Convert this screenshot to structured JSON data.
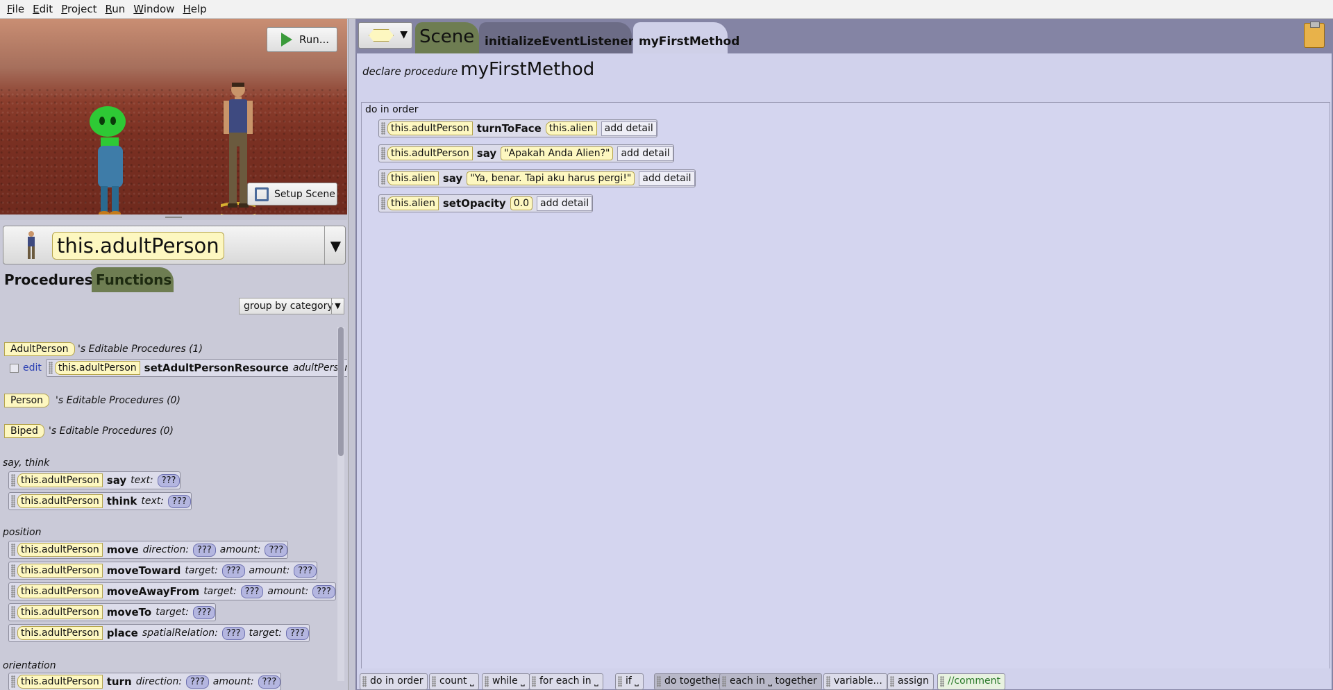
{
  "menu": [
    "File",
    "Edit",
    "Project",
    "Run",
    "Window",
    "Help"
  ],
  "scene_view": {
    "run_label": "Run...",
    "setup_label": "Setup Scene"
  },
  "object_selector": {
    "selected": "this.adultPerson"
  },
  "left_tabs": {
    "procedures": "Procedures",
    "functions": "Functions"
  },
  "group_by": "group by category",
  "editable": [
    {
      "class": "AdultPerson",
      "suffix": "'s Editable Procedures (1)"
    },
    {
      "class": "Person",
      "suffix": "'s Editable Procedures (0)"
    },
    {
      "class": "Biped",
      "suffix": "'s Editable Procedures (0)"
    }
  ],
  "edit_row": {
    "edit": "edit",
    "target": "this.adultPerson",
    "method": "setAdultPersonResource",
    "arg": "adultPerson"
  },
  "categories": {
    "say_think": "say, think",
    "position": "position",
    "orientation": "orientation"
  },
  "proc_blocks": {
    "say": {
      "target": "this.adultPerson",
      "method": "say",
      "args": [
        {
          "name": "text:",
          "val": "???"
        }
      ]
    },
    "think": {
      "target": "this.adultPerson",
      "method": "think",
      "args": [
        {
          "name": "text:",
          "val": "???"
        }
      ]
    },
    "move": {
      "target": "this.adultPerson",
      "method": "move",
      "args": [
        {
          "name": "direction:",
          "val": "???"
        },
        {
          "name": "amount:",
          "val": "???"
        }
      ]
    },
    "moveToward": {
      "target": "this.adultPerson",
      "method": "moveToward",
      "args": [
        {
          "name": "target:",
          "val": "???"
        },
        {
          "name": "amount:",
          "val": "???"
        }
      ]
    },
    "moveAwayFrom": {
      "target": "this.adultPerson",
      "method": "moveAwayFrom",
      "args": [
        {
          "name": "target:",
          "val": "???"
        },
        {
          "name": "amount:",
          "val": "???"
        }
      ]
    },
    "moveTo": {
      "target": "this.adultPerson",
      "method": "moveTo",
      "args": [
        {
          "name": "target:",
          "val": "???"
        }
      ]
    },
    "place": {
      "target": "this.adultPerson",
      "method": "place",
      "args": [
        {
          "name": "spatialRelation:",
          "val": "???"
        },
        {
          "name": "target:",
          "val": "???"
        }
      ]
    },
    "turn": {
      "target": "this.adultPerson",
      "method": "turn",
      "args": [
        {
          "name": "direction:",
          "val": "???"
        },
        {
          "name": "amount:",
          "val": "???"
        }
      ]
    }
  },
  "editor_tabs": {
    "scene": "Scene",
    "init": "initializeEventListeners",
    "active": "myFirstMethod"
  },
  "declaration": {
    "keyword": "declare procedure",
    "name": "myFirstMethod"
  },
  "do_in_order_label": "do in order",
  "statements": [
    {
      "target": "this.adultPerson",
      "method": "turnToFace",
      "arg": "this.alien",
      "detail": "add detail"
    },
    {
      "target": "this.adultPerson",
      "method": "say",
      "arg": "\"Apakah Anda Alien?\"",
      "detail": "add detail"
    },
    {
      "target": "this.alien",
      "method": "say",
      "arg": "\"Ya, benar. Tapi aku harus pergi!\"",
      "detail": "add detail"
    },
    {
      "target": "this.alien",
      "method": "setOpacity",
      "arg": "0.0",
      "detail": "add detail"
    }
  ],
  "control_palette": [
    "do in order",
    "count ⎵",
    "while ⎵",
    "for each in ⎵",
    "if ⎵",
    "do together",
    "each in ⎵ together",
    "variable...",
    "assign",
    "//comment"
  ],
  "colors": {
    "object_tile": "#fdf7c0",
    "question_tile": "#b4b6e0",
    "functions_tab": "#6e7d52",
    "editor_bg": "#d1d2ec"
  }
}
